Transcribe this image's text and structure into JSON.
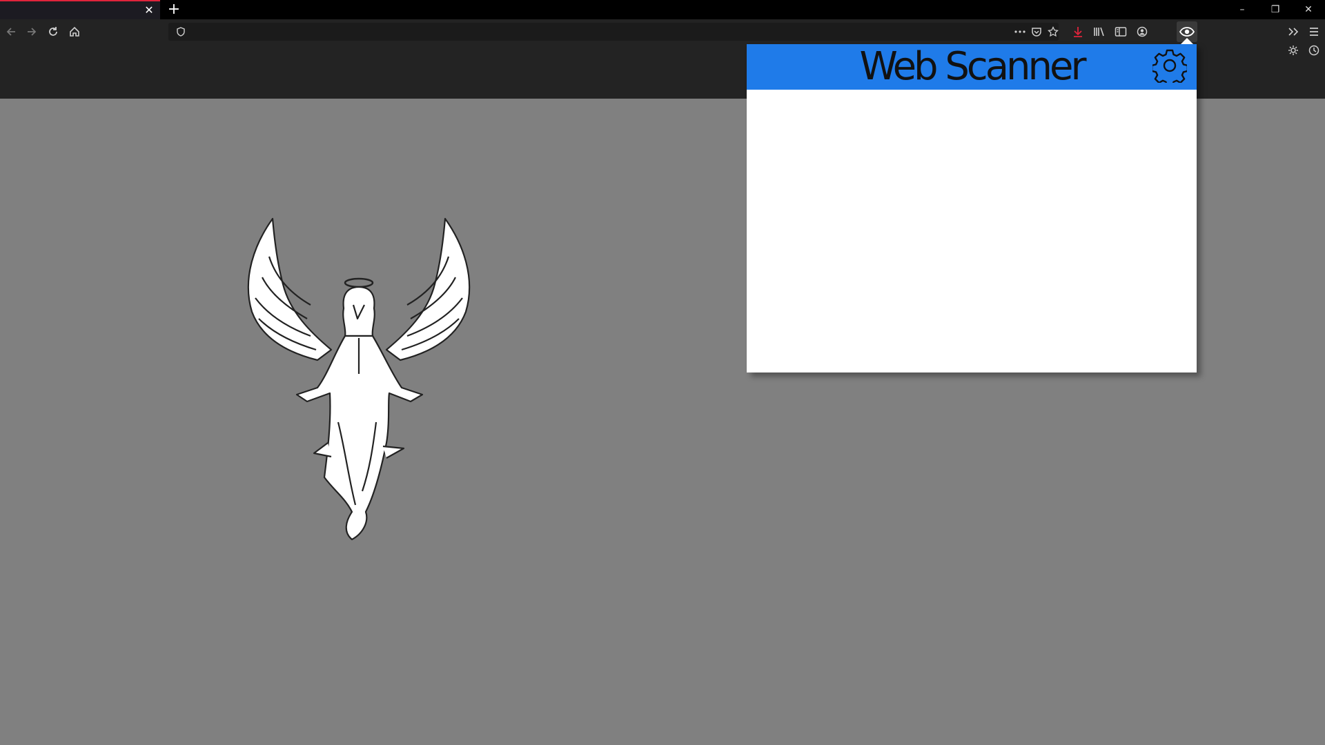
{
  "window": {
    "tab_close": "✕",
    "new_tab": "+",
    "minimize": "–",
    "restore": "❐",
    "close": "✕"
  },
  "toolbar": {
    "url": "",
    "icons": [
      "back-icon",
      "forward-icon",
      "reload-icon",
      "home-icon",
      "shield-icon",
      "more-icon",
      "pocket-icon",
      "star-icon",
      "download-icon",
      "library-icon",
      "sidebar-icon",
      "account-icon",
      "eye-extension-icon",
      "overflow-icon",
      "menu-icon",
      "settings-sun-icon",
      "clock-icon"
    ],
    "download_color": "#e0243c"
  },
  "popup": {
    "title": "Web Scanner",
    "header_color": "#1f7be9",
    "settings_icon": "gear-icon"
  },
  "page": {
    "background_color": "#808080",
    "image": "angel-illustration"
  }
}
